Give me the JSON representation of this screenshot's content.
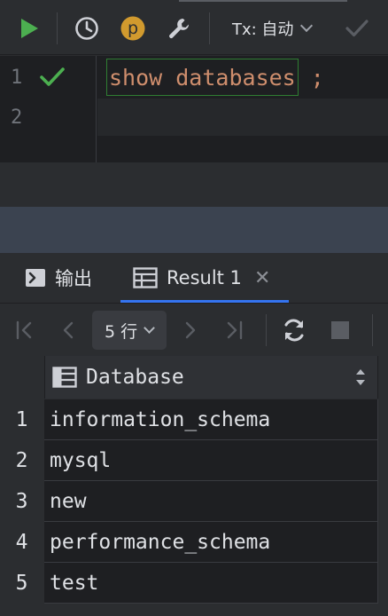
{
  "toolbar": {
    "tx_label": "Tx: 自动",
    "icons": [
      "run-icon",
      "history-icon",
      "profile-icon",
      "settings-wrench-icon",
      "commit-check-icon"
    ],
    "profile_letter": "p"
  },
  "editor": {
    "lines": [
      {
        "number": "1",
        "statement": "show databases",
        "terminator": ";"
      },
      {
        "number": "2"
      }
    ]
  },
  "tabs": {
    "output_label": "输出",
    "result_label": "Result 1",
    "close_glyph": "✕"
  },
  "result_toolbar": {
    "rows_label": "5 行"
  },
  "grid": {
    "column_header": "Database",
    "rows": [
      {
        "num": "1",
        "value": "information_schema"
      },
      {
        "num": "2",
        "value": "mysql"
      },
      {
        "num": "3",
        "value": "new"
      },
      {
        "num": "4",
        "value": "performance_schema"
      },
      {
        "num": "5",
        "value": "test"
      }
    ]
  },
  "colors": {
    "run_green": "#4caf50",
    "profile_orange": "#d19a2e",
    "keyword": "#cf8e6d",
    "accent_blue": "#3574f0"
  }
}
